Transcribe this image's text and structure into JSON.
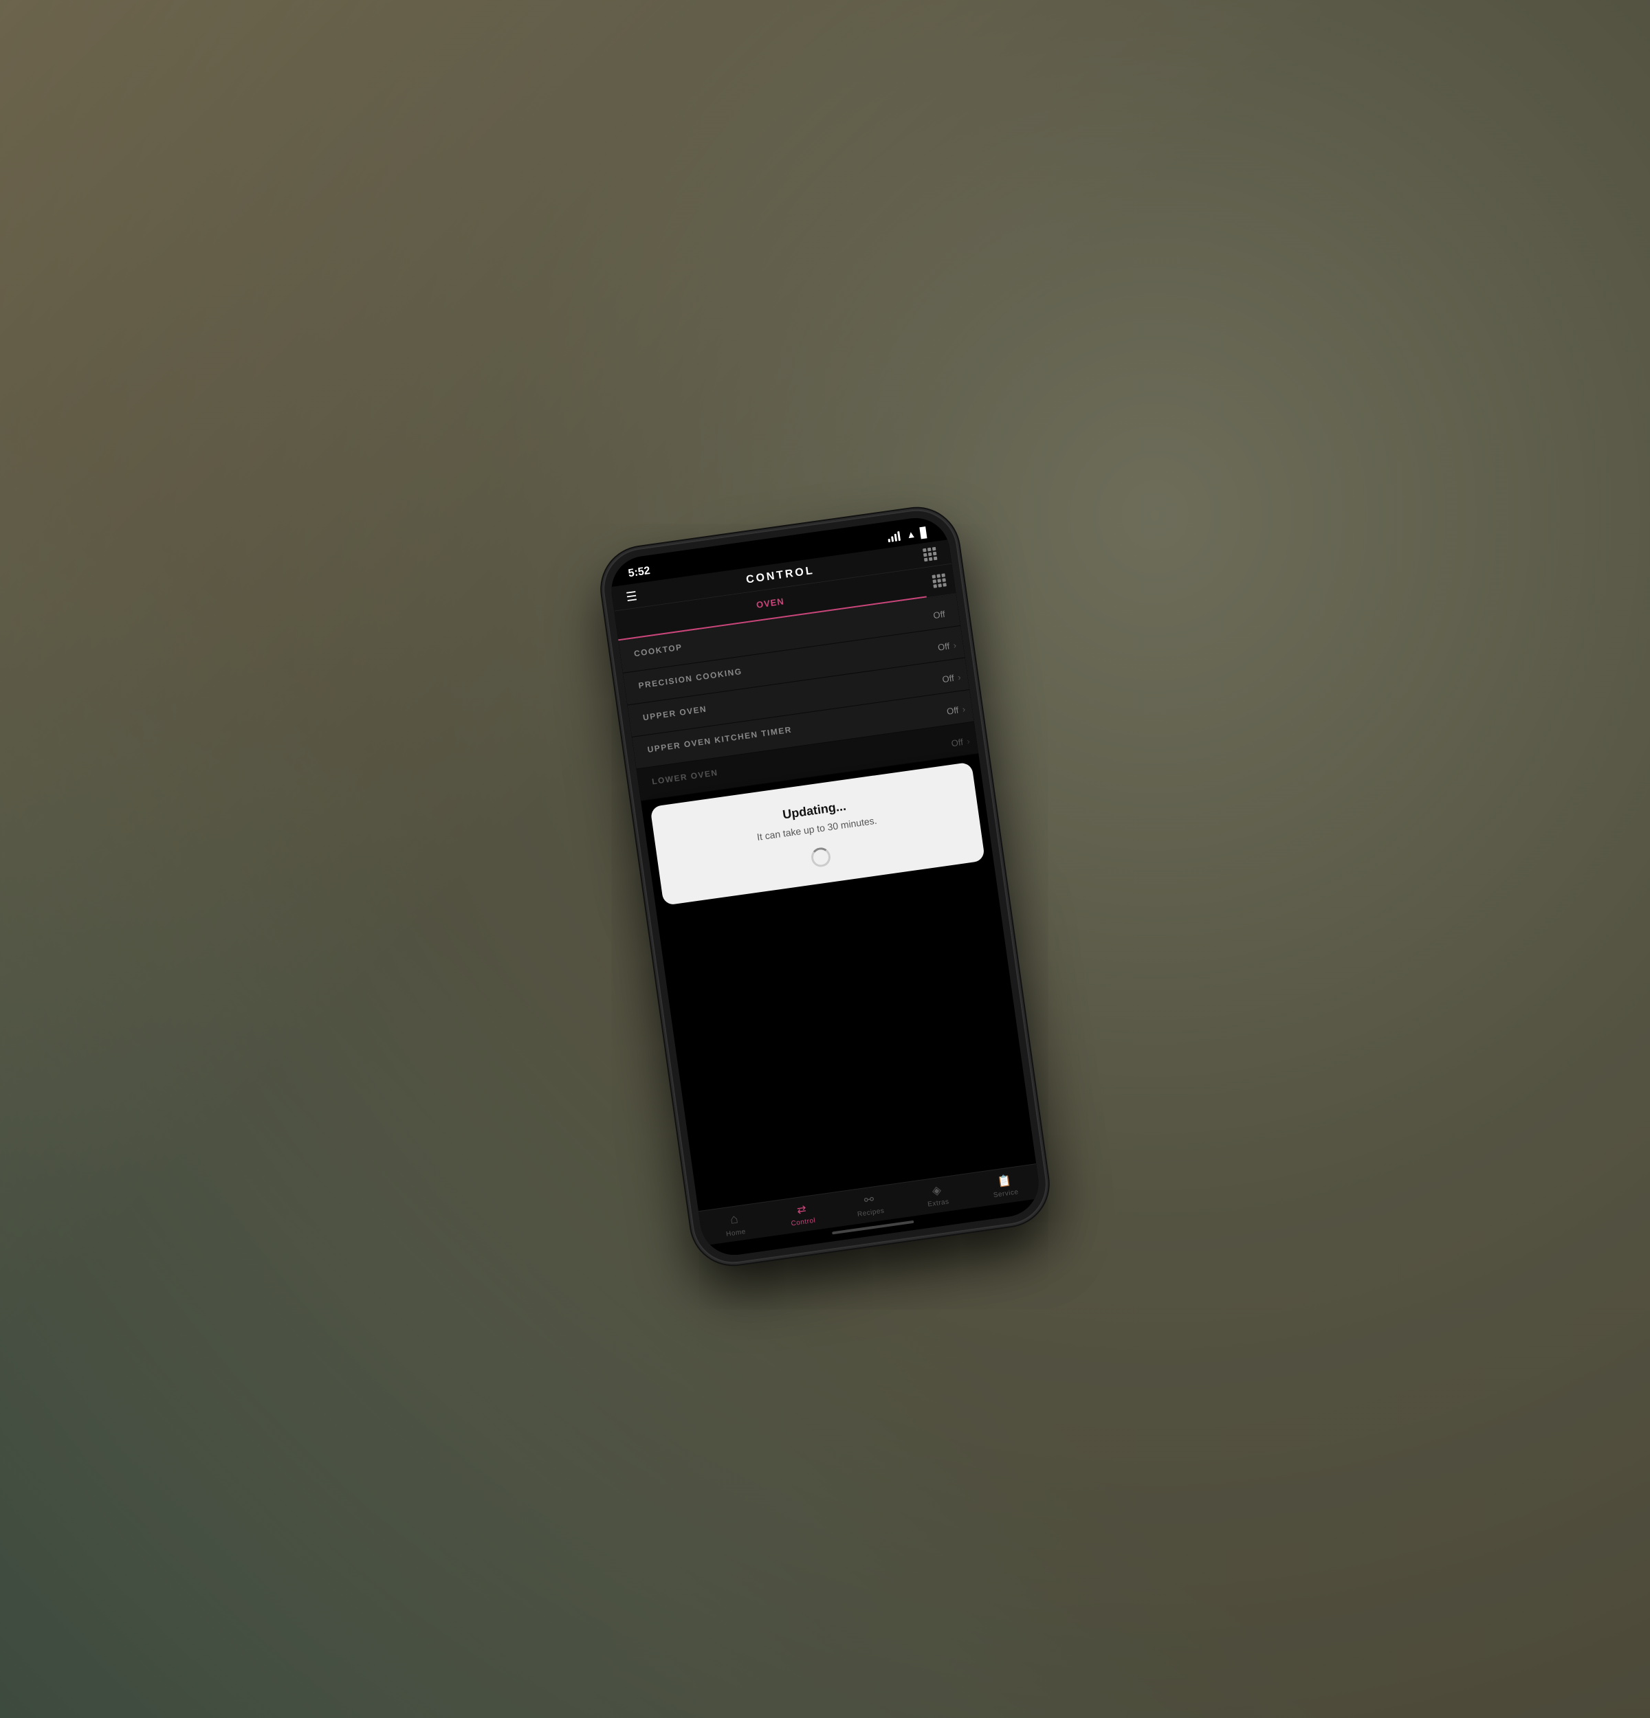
{
  "status_bar": {
    "time": "5:52",
    "signal_label": "signal",
    "wifi_label": "wifi",
    "battery_label": "battery"
  },
  "header": {
    "title": "CONTROL",
    "menu_icon": "☰",
    "add_icon": "⊞"
  },
  "tabs_top": {
    "oven": "OVEN",
    "apps_icon": "⋮⋮⋮"
  },
  "controls": [
    {
      "label": "COOKTOP",
      "value": "Off",
      "has_chevron": false
    },
    {
      "label": "PRECISION COOKING",
      "value": "Off",
      "has_chevron": true
    },
    {
      "label": "UPPER OVEN",
      "value": "Off",
      "has_chevron": true
    },
    {
      "label": "UPPER OVEN KITCHEN TIMER",
      "value": "Off",
      "has_chevron": true
    },
    {
      "label": "LOWER OVEN",
      "value": "Off",
      "has_chevron": true
    }
  ],
  "modal": {
    "title": "Updating...",
    "subtitle": "It can take up to 30 minutes."
  },
  "bottom_nav": [
    {
      "id": "home",
      "label": "Home",
      "active": false
    },
    {
      "id": "control",
      "label": "Control",
      "active": true
    },
    {
      "id": "recipes",
      "label": "Recipes",
      "active": false
    },
    {
      "id": "extras",
      "label": "Extras",
      "active": false
    },
    {
      "id": "service",
      "label": "Service",
      "active": false
    }
  ],
  "colors": {
    "accent": "#c9457a",
    "bg_dark": "#000000",
    "bg_card": "#1a1a1a",
    "text_muted": "#888888"
  }
}
